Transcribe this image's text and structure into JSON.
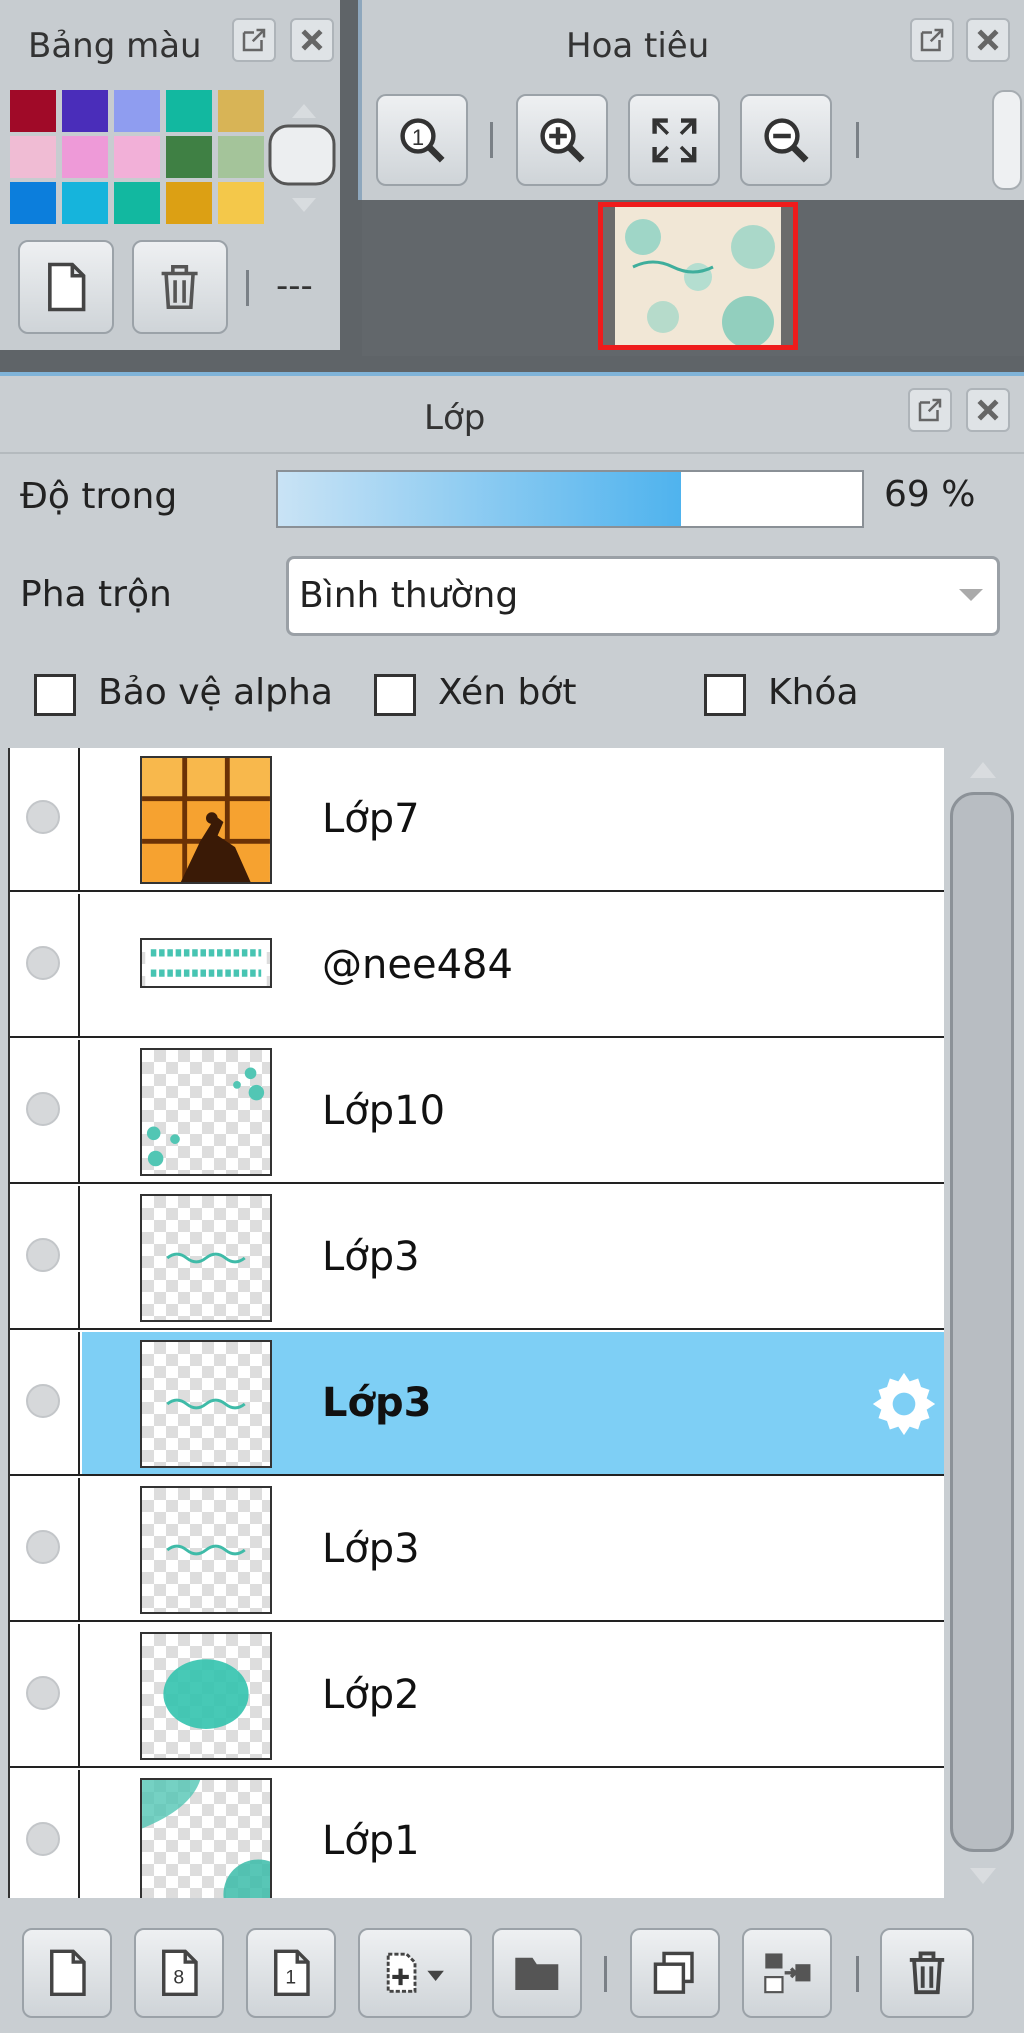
{
  "swatch_panel": {
    "title": "Bảng màu",
    "swatches": [
      "#a00a28",
      "#4a2dba",
      "#8f9df0",
      "#12b8a0",
      "#d8b456",
      "#f0bcd4",
      "#ee9ad8",
      "#f2b0d8",
      "#3f8044",
      "#a4c49a",
      "#0c7edc",
      "#16b4dc",
      "#12b8a0",
      "#dca014",
      "#f4c84a"
    ],
    "extra_label": "---"
  },
  "navigator_panel": {
    "title": "Hoa tiêu"
  },
  "layer_panel": {
    "title": "Lớp",
    "opacity_label": "Độ trong",
    "opacity_fraction": 0.69,
    "opacity_text": "69 %",
    "blend_label": "Pha trộn",
    "blend_value": "Bình thường",
    "options": {
      "alpha_protect": "Bảo vệ alpha",
      "clipping": "Xén bớt",
      "lock": "Khóa"
    },
    "layers": [
      {
        "name": "Lớp7",
        "thumb": "photo"
      },
      {
        "name": "@nee484",
        "thumb": "text"
      },
      {
        "name": "Lớp10",
        "thumb": "dots"
      },
      {
        "name": "Lớp3",
        "thumb": "script"
      },
      {
        "name": "Lớp3",
        "thumb": "script",
        "selected": true
      },
      {
        "name": "Lớp3",
        "thumb": "script"
      },
      {
        "name": "Lớp2",
        "thumb": "blob"
      },
      {
        "name": "Lớp1",
        "thumb": "corners"
      }
    ]
  },
  "colors": {
    "selected_row": "#7ecff5",
    "accent_blue": "#4fb3ee",
    "teal": "#2fc4b2",
    "nav_frame": "#ee1c1c"
  }
}
